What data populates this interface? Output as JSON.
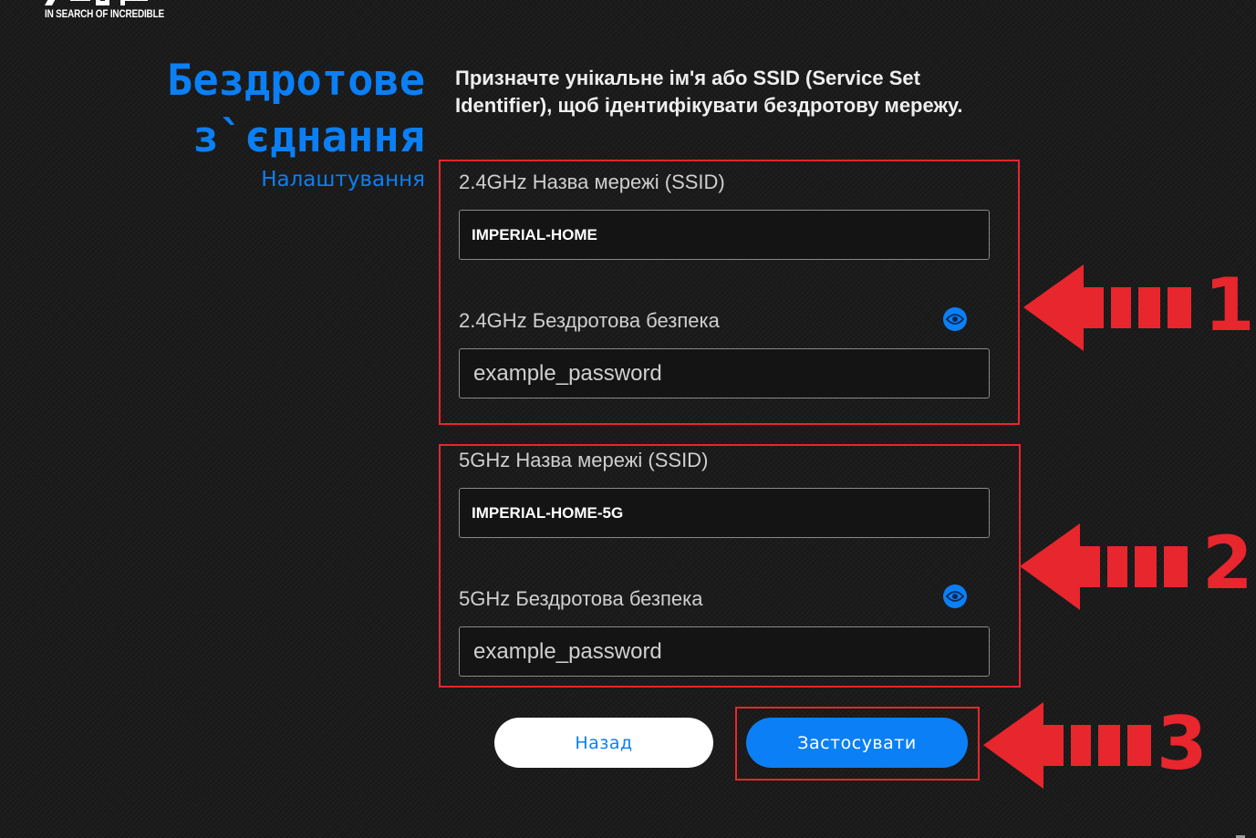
{
  "logo": {
    "brand": "ASUS",
    "tagline": "IN SEARCH OF INCREDIBLE"
  },
  "heading": {
    "title": "Бездротове\nз`єднання",
    "subtitle": "Налаштування"
  },
  "description": "Призначте унікальне ім'я або SSID (Service Set Identifier), щоб ідентифікувати бездротову мережу.",
  "band_24": {
    "ssid_label": "2.4GHz Назва мережі (SSID)",
    "ssid_value": "IMPERIAL-HOME",
    "security_label": "2.4GHz Бездротова безпека",
    "password_value": "example_password"
  },
  "band_5": {
    "ssid_label": "5GHz Назва мережі (SSID)",
    "ssid_value": "IMPERIAL-HOME-5G",
    "security_label": "5GHz Бездротова безпека",
    "password_value": "example_password"
  },
  "buttons": {
    "back_label": "Назад",
    "apply_label": "Застосувати"
  },
  "annotations": {
    "arrow_1": "1",
    "arrow_2": "2",
    "arrow_3": "3"
  },
  "colors": {
    "accent": "#0b7ff5",
    "highlight": "#e8262d",
    "background": "#1c1c1c"
  },
  "icons": {
    "show_password": "eye-icon"
  }
}
